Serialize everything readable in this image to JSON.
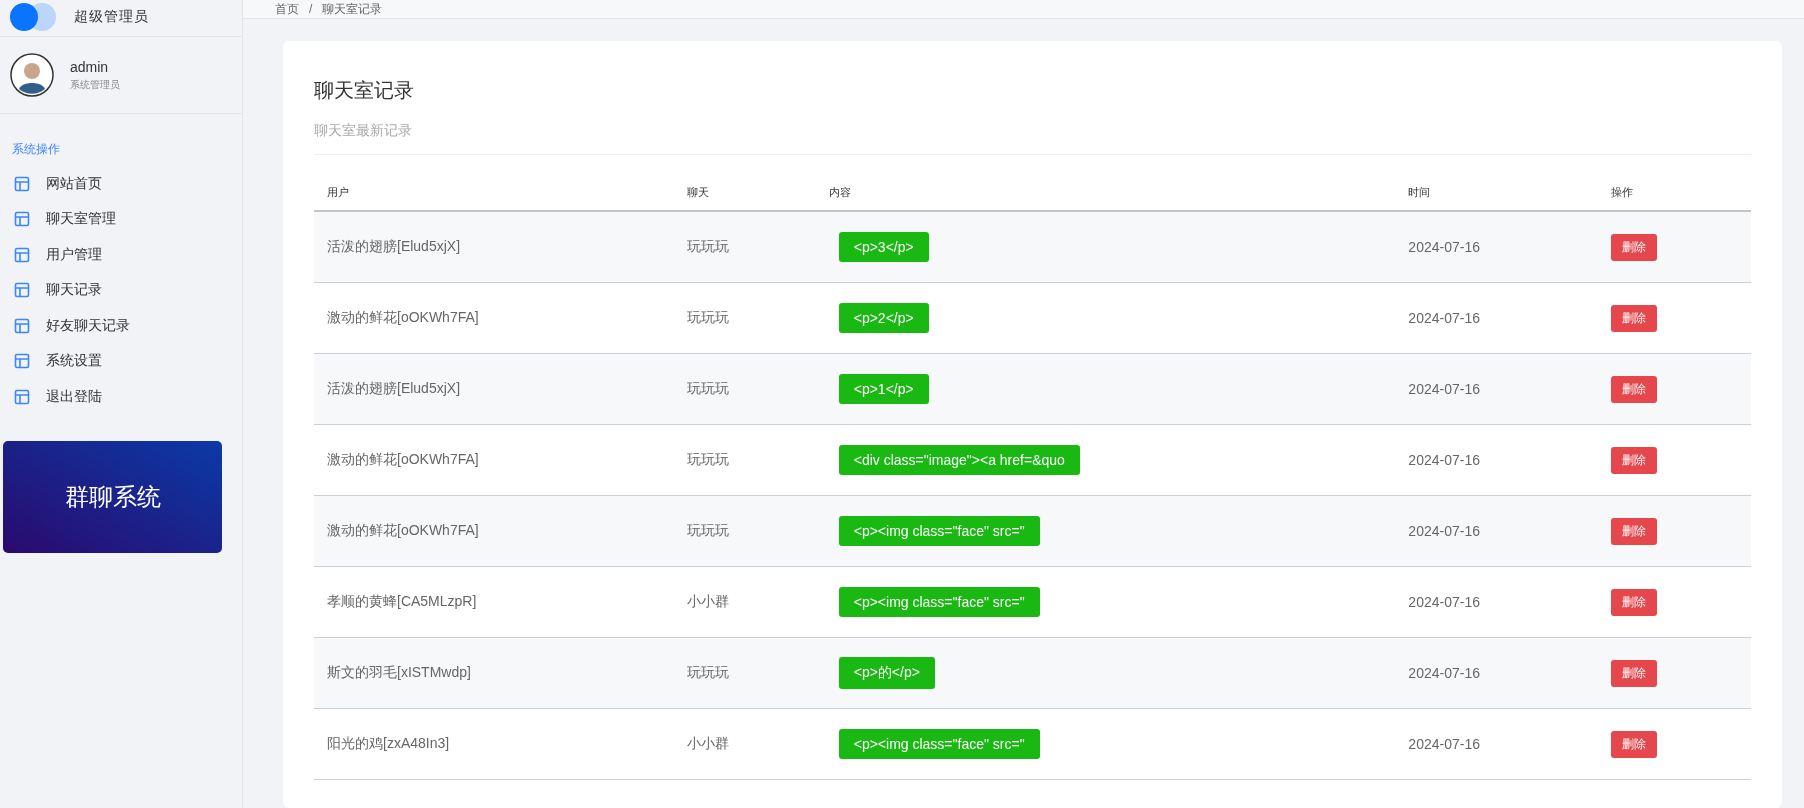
{
  "brand": {
    "title": "超级管理员"
  },
  "user": {
    "name": "admin",
    "role": "系统管理员"
  },
  "sidebar": {
    "section": "系统操作",
    "items": [
      {
        "label": "网站首页"
      },
      {
        "label": "聊天室管理"
      },
      {
        "label": "用户管理"
      },
      {
        "label": "聊天记录"
      },
      {
        "label": "好友聊天记录"
      },
      {
        "label": "系统设置"
      },
      {
        "label": "退出登陆"
      }
    ],
    "banner": "群聊系统"
  },
  "breadcrumb": {
    "items": [
      "首页",
      "聊天室记录"
    ],
    "separator": "/"
  },
  "card": {
    "title": "聊天室记录",
    "subtitle": "聊天室最新记录"
  },
  "table": {
    "columns": [
      "用户",
      "聊天",
      "内容",
      "时间",
      "操作"
    ],
    "rows": [
      {
        "user": "活泼的翅膀[Elud5xjX]",
        "chat": "玩玩玩",
        "content": "<p>3</p>",
        "time": "2024-07-16",
        "action": "删除"
      },
      {
        "user": "激动的鲜花[oOKWh7FA]",
        "chat": "玩玩玩",
        "content": "<p>2</p>",
        "time": "2024-07-16",
        "action": "删除"
      },
      {
        "user": "活泼的翅膀[Elud5xjX]",
        "chat": "玩玩玩",
        "content": "<p>1</p>",
        "time": "2024-07-16",
        "action": "删除"
      },
      {
        "user": "激动的鲜花[oOKWh7FA]",
        "chat": "玩玩玩",
        "content": "<div class=\"image\"><a href=&quo",
        "time": "2024-07-16",
        "action": "删除"
      },
      {
        "user": "激动的鲜花[oOKWh7FA]",
        "chat": "玩玩玩",
        "content": "<p><img class=\"face\" src=\"",
        "time": "2024-07-16",
        "action": "删除"
      },
      {
        "user": "孝顺的黄蜂[CA5MLzpR]",
        "chat": "小小群",
        "content": "<p><img class=\"face\" src=\"",
        "time": "2024-07-16",
        "action": "删除"
      },
      {
        "user": "斯文的羽毛[xISTMwdp]",
        "chat": "玩玩玩",
        "content": "<p>的</p>",
        "time": "2024-07-16",
        "action": "删除"
      },
      {
        "user": "阳光的鸡[zxA48In3]",
        "chat": "小小群",
        "content": "<p><img class=\"face\" src=\"",
        "time": "2024-07-16",
        "action": "删除"
      }
    ]
  }
}
